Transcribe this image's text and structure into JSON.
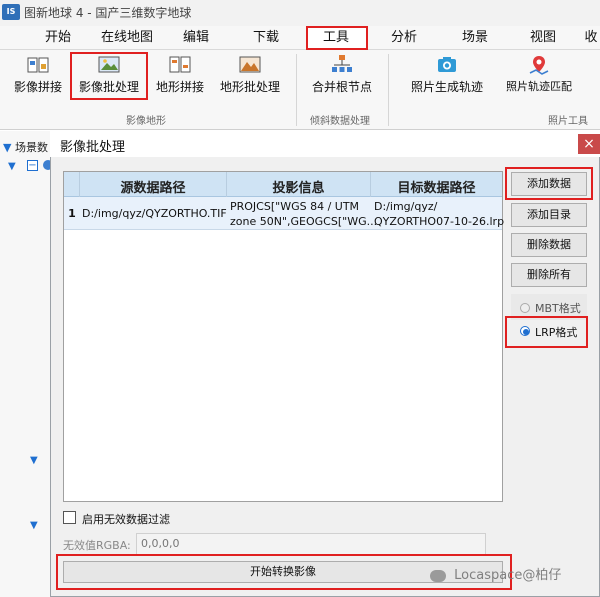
{
  "window": {
    "logo": "IS",
    "title": "图新地球 4 - 国产三维数字地球"
  },
  "ribbon_tabs": [
    "开始",
    "在线地图",
    "编辑",
    "下载",
    "工具",
    "分析",
    "场景",
    "视图",
    "收"
  ],
  "ribbon_buttons": [
    {
      "label": "影像拼接",
      "icon": "image-mosaic-icon"
    },
    {
      "label": "影像批处理",
      "icon": "image-batch-icon"
    },
    {
      "label": "地形拼接",
      "icon": "terrain-mosaic-icon"
    },
    {
      "label": "地形批处理",
      "icon": "terrain-batch-icon"
    },
    {
      "label": "合并根节点",
      "icon": "merge-root-icon"
    },
    {
      "label": "照片生成轨迹",
      "icon": "camera-icon"
    },
    {
      "label": "照片轨迹匹配",
      "icon": "photo-track-icon"
    }
  ],
  "ribbon_groups": [
    "影像地形",
    "倾斜数据处理",
    "照片工具"
  ],
  "left_panel": {
    "label": "场景数"
  },
  "dialog": {
    "title": "影像批处理",
    "close": "×",
    "columns": [
      "源数据路径",
      "投影信息",
      "目标数据路径"
    ],
    "rows": [
      {
        "index": "1",
        "source": "D:/img/qyz/QYZORTHO.TIF",
        "projection_line1": "PROJCS[\"WGS 84 / UTM",
        "projection_line2": "zone 50N\",GEOGCS[\"WG...",
        "target_line1": "D:/img/qyz/",
        "target_line2": "QYZORTHO07-10-26.lrp"
      }
    ],
    "buttons": {
      "add_data": "添加数据",
      "add_dir": "添加目录",
      "delete_data": "删除数据",
      "delete_all": "删除所有"
    },
    "formats": {
      "mbt": "MBT格式",
      "lrp": "LRP格式",
      "selected": "LRP格式"
    },
    "filter_label": "启用无效数据过滤",
    "rgba_label": "无效值RGBA:",
    "rgba_value": "0,0,0,0",
    "start_button": "开始转换影像"
  },
  "watermark": "Locaspace@柏仔",
  "colors": {
    "highlight_red": "#e02020",
    "grid_header": "#cfe3f4",
    "radio_on": "#1f6fd0"
  }
}
